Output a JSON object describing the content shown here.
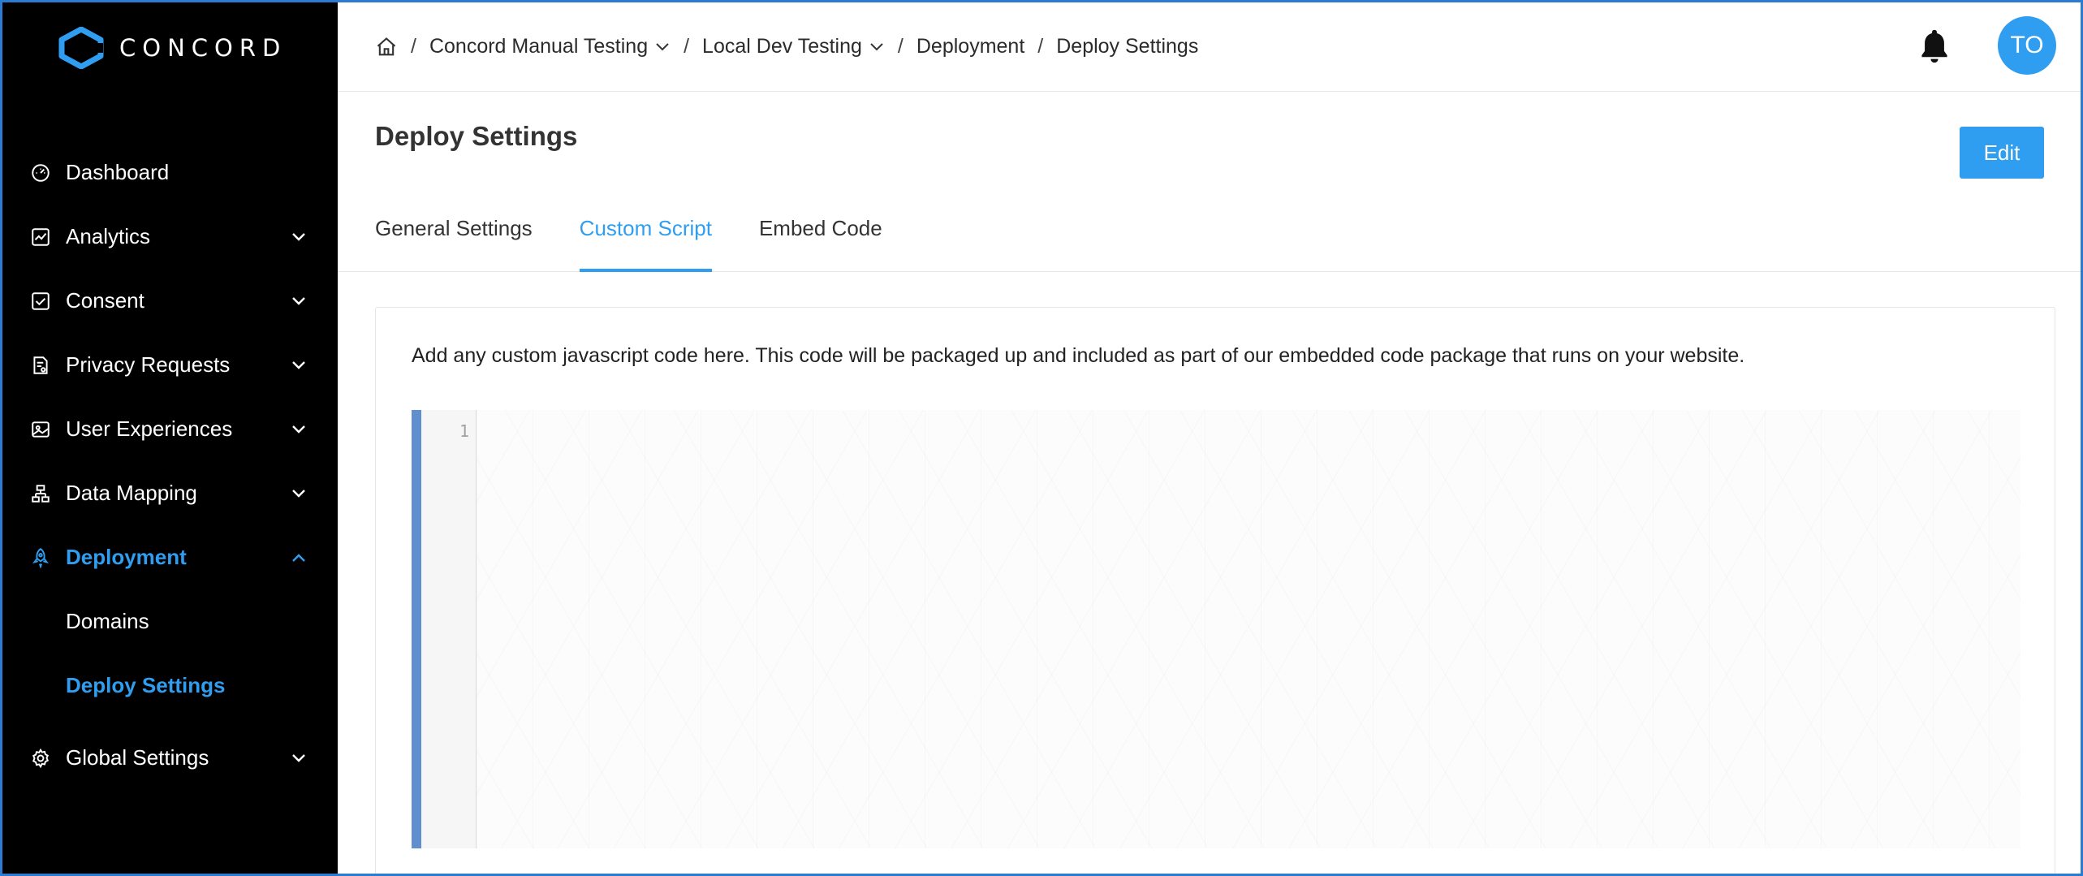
{
  "brand": {
    "name": "CONCORD"
  },
  "sidebar": {
    "items": [
      {
        "label": "Dashboard",
        "icon": "dashboard-gauge-icon"
      },
      {
        "label": "Analytics",
        "icon": "chart-line-icon"
      },
      {
        "label": "Consent",
        "icon": "checkbox-icon"
      },
      {
        "label": "Privacy Requests",
        "icon": "document-icon"
      },
      {
        "label": "User Experiences",
        "icon": "image-icon"
      },
      {
        "label": "Data Mapping",
        "icon": "hierarchy-icon"
      },
      {
        "label": "Deployment",
        "icon": "rocket-icon",
        "active": true,
        "children": [
          {
            "label": "Domains"
          },
          {
            "label": "Deploy Settings",
            "active": true
          }
        ]
      },
      {
        "label": "Global Settings",
        "icon": "gear-icon"
      }
    ]
  },
  "breadcrumb": {
    "items": [
      "Concord Manual Testing",
      "Local Dev Testing",
      "Deployment",
      "Deploy Settings"
    ],
    "separator": "/"
  },
  "user": {
    "initials": "TO"
  },
  "page": {
    "title": "Deploy Settings",
    "edit_label": "Edit",
    "tabs": [
      {
        "label": "General Settings"
      },
      {
        "label": "Custom Script",
        "active": true
      },
      {
        "label": "Embed Code"
      }
    ],
    "description": "Add any custom javascript code here. This code will be packaged up and included as part of our embedded code package that runs on your website.",
    "editor": {
      "line_number": "1",
      "content": ""
    }
  },
  "colors": {
    "accent": "#2f9ef0",
    "sidebar_bg": "#000000",
    "editor_bar": "#5f8fce"
  }
}
